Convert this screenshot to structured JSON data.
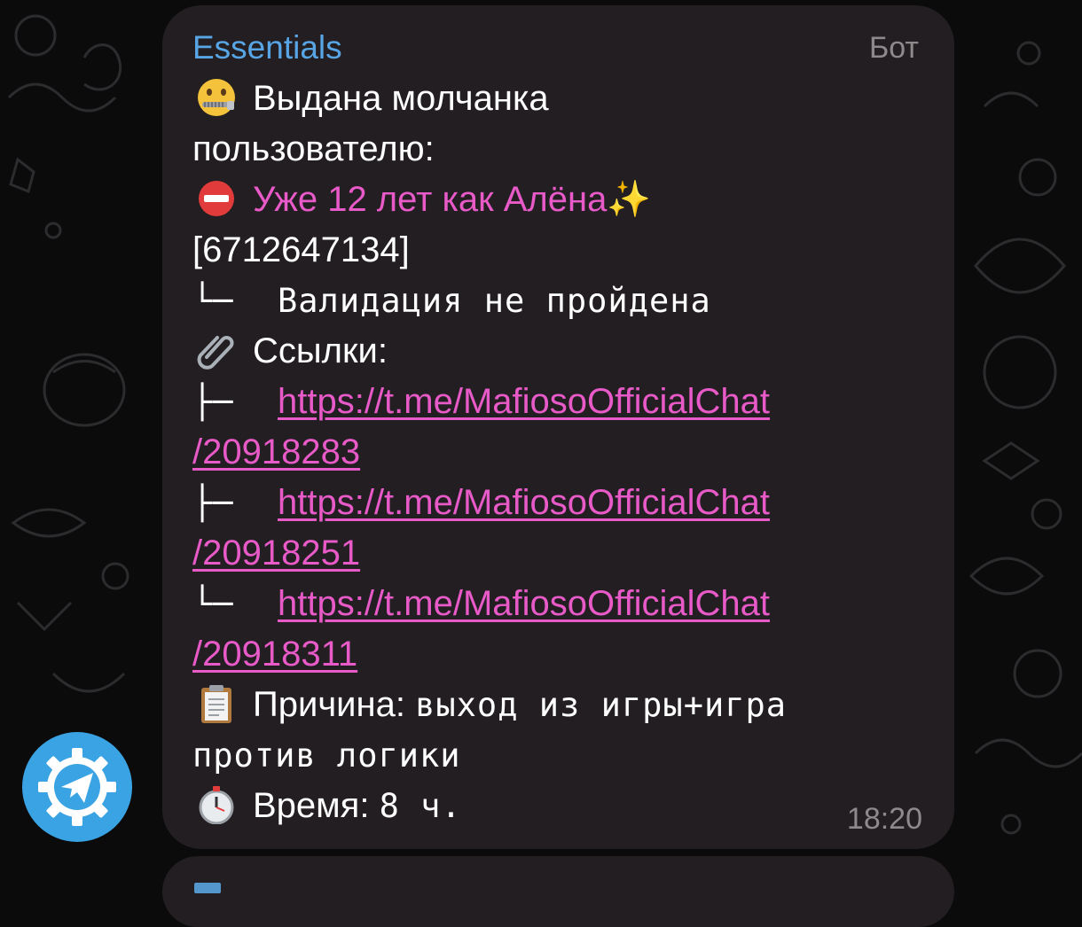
{
  "message": {
    "sender": "Essentials",
    "badge": "Бот",
    "line1_text": "Выдана молчанка",
    "line2_text": "пользователю:",
    "user_name": "Уже 12 лет как Алёна✨",
    "user_id": "[6712647134]",
    "validation_prefix": "└─",
    "validation_text": "Валидация не пройдена",
    "links_label": "Ссылки:",
    "links": [
      {
        "prefix": "├─",
        "line1": "https://t.me/MafiosoOfficialChat",
        "line2": "/20918283"
      },
      {
        "prefix": "├─",
        "line1": "https://t.me/MafiosoOfficialChat",
        "line2": "/20918251"
      },
      {
        "prefix": "└─",
        "line1": "https://t.me/MafiosoOfficialChat",
        "line2": "/20918311"
      }
    ],
    "reason_label": "Причина:",
    "reason_value_1": "выход из игры+игра",
    "reason_value_2": "против логики",
    "time_label": "Время:",
    "time_value": "8 ч.",
    "timestamp": "18:20"
  },
  "icons": {
    "muted": "zipper-mouth-face-icon",
    "restricted": "no-entry-icon",
    "links": "paperclip-icon",
    "reason": "clipboard-icon",
    "time": "stopwatch-icon",
    "fab": "telegram-settings-icon"
  },
  "colors": {
    "sender": "#58a5e6",
    "accent_pink": "#e85ac8",
    "bubble": "#221e21",
    "fab": "#3aa3e3"
  }
}
